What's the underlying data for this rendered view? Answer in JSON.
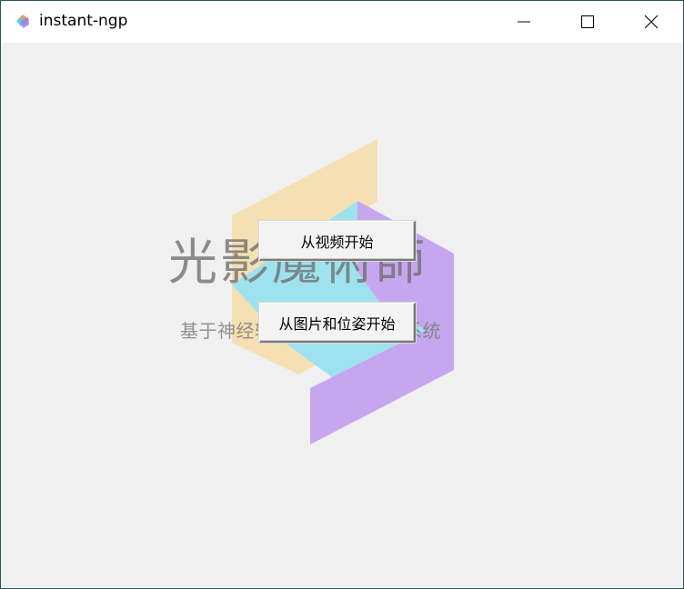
{
  "window": {
    "title": "instant-ngp",
    "app_icon": "instant-ngp-app-icon",
    "controls": {
      "minimize_icon": "minimize-icon",
      "maximize_icon": "maximize-icon",
      "close_icon": "close-icon"
    }
  },
  "logo": {
    "title": "光影魔術師",
    "subtitle": "基于神经辐射场的三维重建系统",
    "colors": {
      "yellow": "#f5e0b3",
      "cyan": "#9ee2ef",
      "purple": "#c6a6ef"
    }
  },
  "buttons": {
    "from_video": "从视频开始",
    "from_images_poses": "从图片和位姿开始"
  }
}
